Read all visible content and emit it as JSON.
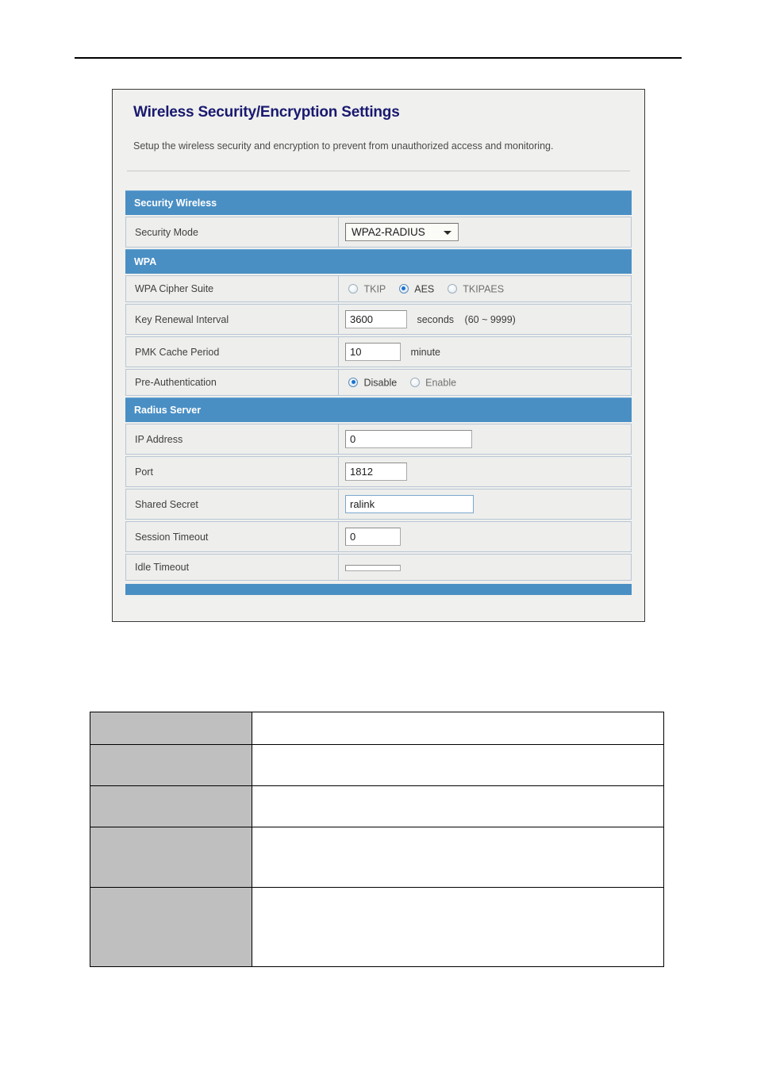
{
  "panel": {
    "title": "Wireless Security/Encryption Settings",
    "description": "Setup the wireless security and encryption to prevent from unauthorized access and monitoring.",
    "sections": {
      "security_wireless": {
        "header": "Security Wireless",
        "security_mode": {
          "label": "Security Mode",
          "value": "WPA2-RADIUS",
          "caret_icon": "chevron-down-icon"
        }
      },
      "wpa": {
        "header": "WPA",
        "cipher_suite": {
          "label": "WPA Cipher Suite",
          "options": [
            {
              "label": "TKIP",
              "selected": false
            },
            {
              "label": "AES",
              "selected": true
            },
            {
              "label": "TKIPAES",
              "selected": false
            }
          ]
        },
        "key_renewal_interval": {
          "label": "Key Renewal Interval",
          "value": "3600",
          "unit": "seconds",
          "hint": "(60 ~ 9999)"
        },
        "pmk_cache_period": {
          "label": "PMK Cache Period",
          "value": "10",
          "unit": "minute"
        },
        "pre_authentication": {
          "label": "Pre-Authentication",
          "options": [
            {
              "label": "Disable",
              "selected": true
            },
            {
              "label": "Enable",
              "selected": false
            }
          ]
        }
      },
      "radius_server": {
        "header": "Radius Server",
        "ip_address": {
          "label": "IP Address",
          "value": "0"
        },
        "port": {
          "label": "Port",
          "value": "1812"
        },
        "shared_secret": {
          "label": "Shared Secret",
          "value": "ralink"
        },
        "session_timeout": {
          "label": "Session Timeout",
          "value": "0"
        },
        "idle_timeout": {
          "label": "Idle Timeout",
          "value": ""
        }
      }
    }
  },
  "description_table": {
    "headers": [
      "",
      ""
    ],
    "rows": [
      {
        "term": "",
        "description": ""
      },
      {
        "term": "",
        "description": ""
      },
      {
        "term": "",
        "description": ""
      },
      {
        "term": "",
        "description": ""
      }
    ]
  },
  "colors": {
    "section_header_blue": "#4a8fc4",
    "panel_title_navy": "#191970",
    "table_header_navy": "#033163",
    "table_term_gray": "#bfbfbf",
    "radio_selected_blue": "#1b72d0"
  }
}
